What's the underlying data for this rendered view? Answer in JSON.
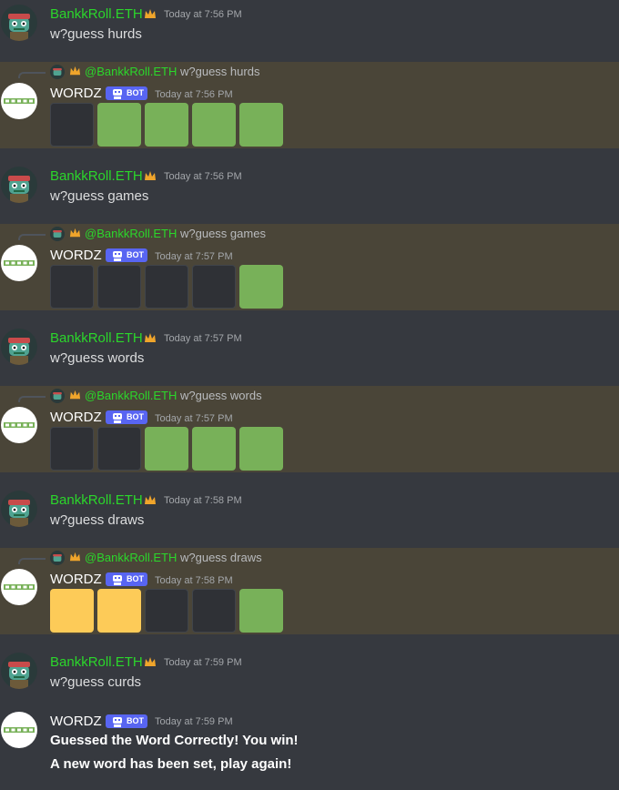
{
  "colors": {
    "green": "#78b159",
    "yellow": "#fdcb58",
    "gray": "#2f3136",
    "accent": "#5865f2",
    "username": "#2bd62b"
  },
  "user": {
    "name": "BankkRoll.ETH",
    "mention": "@BankkRoll.ETH",
    "badge_icon": "crown-icon"
  },
  "bot": {
    "name": "WORDZ",
    "tag": "BOT",
    "avatar_text": "WORDZ"
  },
  "messages": [
    {
      "kind": "user",
      "time": "Today at 7:56 PM",
      "text": "w?guess hurds"
    },
    {
      "kind": "bot",
      "reply": "w?guess hurds",
      "time": "Today at 7:56 PM",
      "tiles": [
        "gray",
        "green",
        "green",
        "green",
        "green"
      ]
    },
    {
      "kind": "user",
      "time": "Today at 7:56 PM",
      "text": "w?guess games"
    },
    {
      "kind": "bot",
      "reply": "w?guess games",
      "time": "Today at 7:57 PM",
      "tiles": [
        "gray",
        "gray",
        "gray",
        "gray",
        "green"
      ]
    },
    {
      "kind": "user",
      "time": "Today at 7:57 PM",
      "text": "w?guess words"
    },
    {
      "kind": "bot",
      "reply": "w?guess words",
      "time": "Today at 7:57 PM",
      "tiles": [
        "gray",
        "gray",
        "green",
        "green",
        "green"
      ]
    },
    {
      "kind": "user",
      "time": "Today at 7:58 PM",
      "text": "w?guess draws"
    },
    {
      "kind": "bot",
      "reply": "w?guess draws",
      "time": "Today at 7:58 PM",
      "tiles": [
        "yellow",
        "yellow",
        "gray",
        "gray",
        "green"
      ]
    },
    {
      "kind": "user",
      "time": "Today at 7:59 PM",
      "text": "w?guess curds"
    },
    {
      "kind": "bot-final",
      "time": "Today at 7:59 PM",
      "line1": "Guessed the Word Correctly! You win!",
      "line2": "A new word has been set, play again!"
    }
  ]
}
